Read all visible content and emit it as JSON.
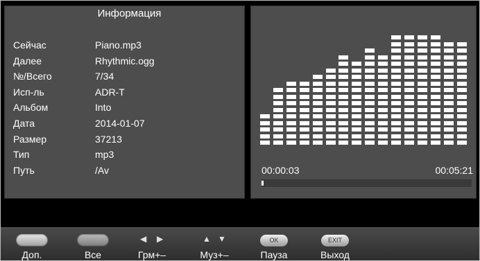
{
  "info_panel": {
    "title": "Информация",
    "rows": [
      {
        "key": "Сейчас",
        "value": "Piano.mp3"
      },
      {
        "key": "Далее",
        "value": "Rhythmic.ogg"
      },
      {
        "key": "№/Всего",
        "value": "7/34"
      },
      {
        "key": "Исп-ль",
        "value": "ADR-T"
      },
      {
        "key": "Альбом",
        "value": "Into"
      },
      {
        "key": "Дата",
        "value": "2014-01-07"
      },
      {
        "key": "Размер",
        "value": "37213"
      },
      {
        "key": "Тип",
        "value": "mp3"
      },
      {
        "key": "Путь",
        "value": "/Av"
      }
    ]
  },
  "player": {
    "elapsed": "00:00:03",
    "total": "00:05:21",
    "progress_percent": 1,
    "equalizer_levels": [
      5,
      9,
      10,
      10,
      11,
      12,
      14,
      13,
      15,
      14,
      17,
      17,
      17,
      17,
      16,
      16
    ]
  },
  "controls": [
    {
      "key": "pill",
      "label": "Доп."
    },
    {
      "key": "pill",
      "label": "Все"
    },
    {
      "key": "left-right-arrows",
      "label": "Грм+–"
    },
    {
      "key": "up-down-arrows",
      "label": "Муз+–"
    },
    {
      "key": "OK",
      "label": "Пауза"
    },
    {
      "key": "EXIT",
      "label": "Выход"
    }
  ],
  "colors": {
    "panel": "#4d4d4d",
    "background": "#000000",
    "text": "#ffffff"
  }
}
